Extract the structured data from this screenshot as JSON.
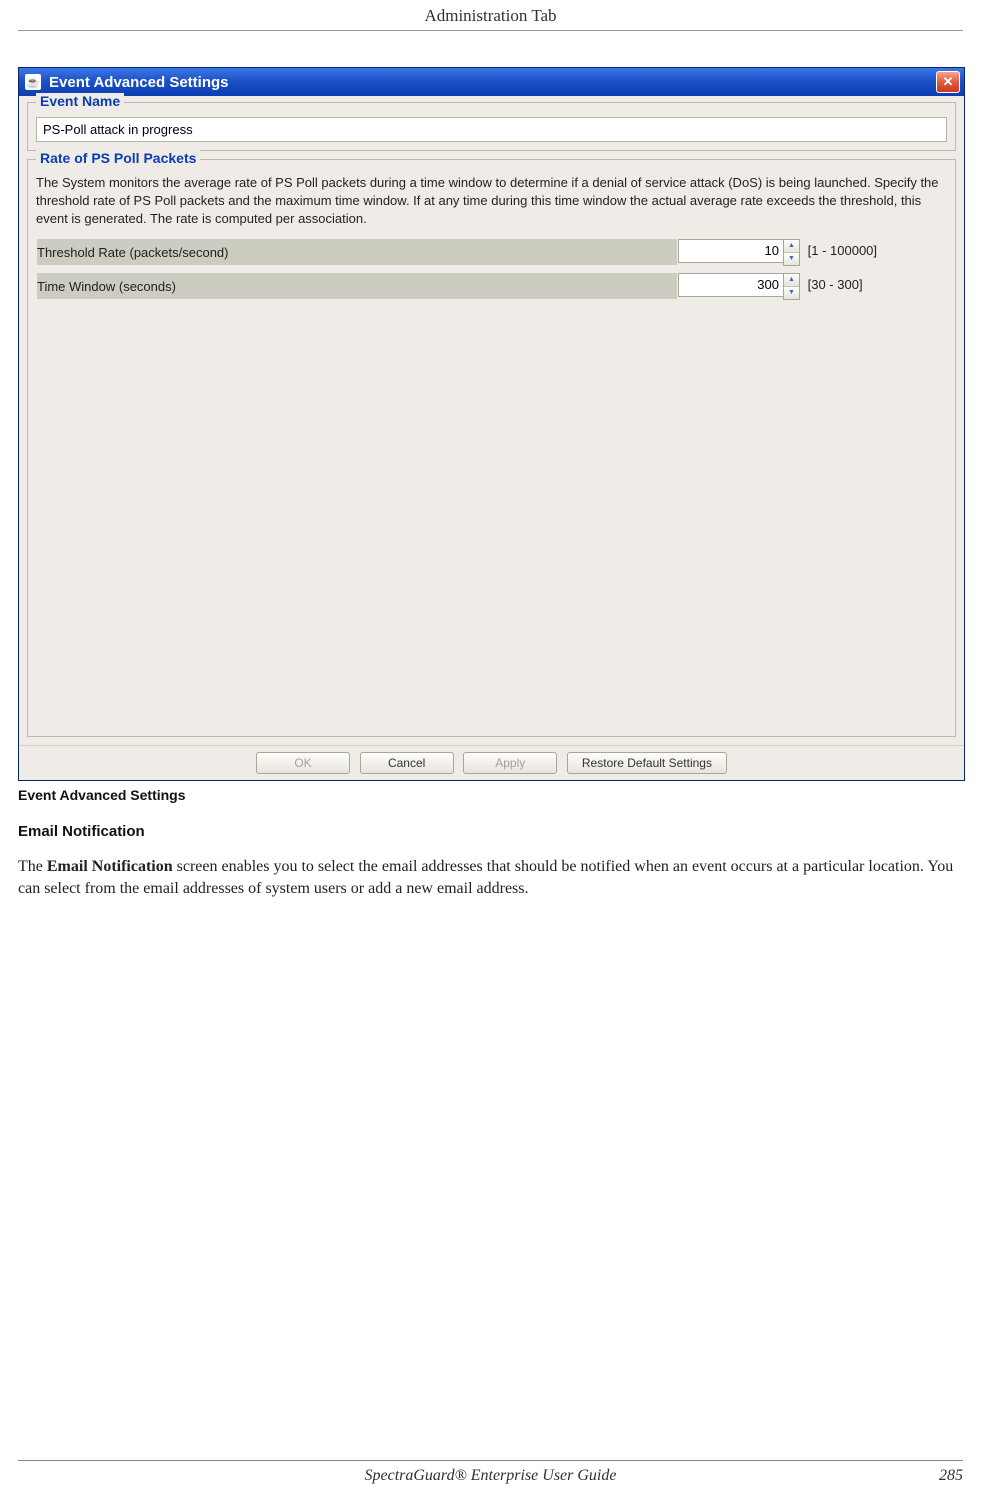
{
  "page_header": "Administration Tab",
  "dialog": {
    "title": "Event Advanced Settings",
    "event_name_label": "Event Name",
    "event_name_value": "PS-Poll attack in progress",
    "group2_label": "Rate of PS Poll Packets",
    "group2_desc": "The System monitors the average rate of PS Poll packets during a time window to determine if a denial of service attack (DoS) is being launched. Specify the threshold rate of PS Poll packets and the maximum time window. If at any time during this time window the actual average rate exceeds the threshold, this event is generated. The rate is computed per association.",
    "params": [
      {
        "label": "Threshold Rate (packets/second)",
        "value": "10",
        "range": "[1 - 100000]"
      },
      {
        "label": "Time Window (seconds)",
        "value": "300",
        "range": "[30 - 300]"
      }
    ],
    "buttons": {
      "ok": "OK",
      "cancel": "Cancel",
      "apply": "Apply",
      "restore": "Restore Default Settings"
    }
  },
  "caption": "Event Advanced Settings",
  "subheading": "Email Notification",
  "para_pre": "The ",
  "para_bold": "Email Notification",
  "para_post": " screen enables you to select the email addresses that should be notified when an event occurs at a particular location. You can select from the email addresses of system users or add a new email address.",
  "footer_center": "SpectraGuard® Enterprise User Guide",
  "footer_right": "285"
}
